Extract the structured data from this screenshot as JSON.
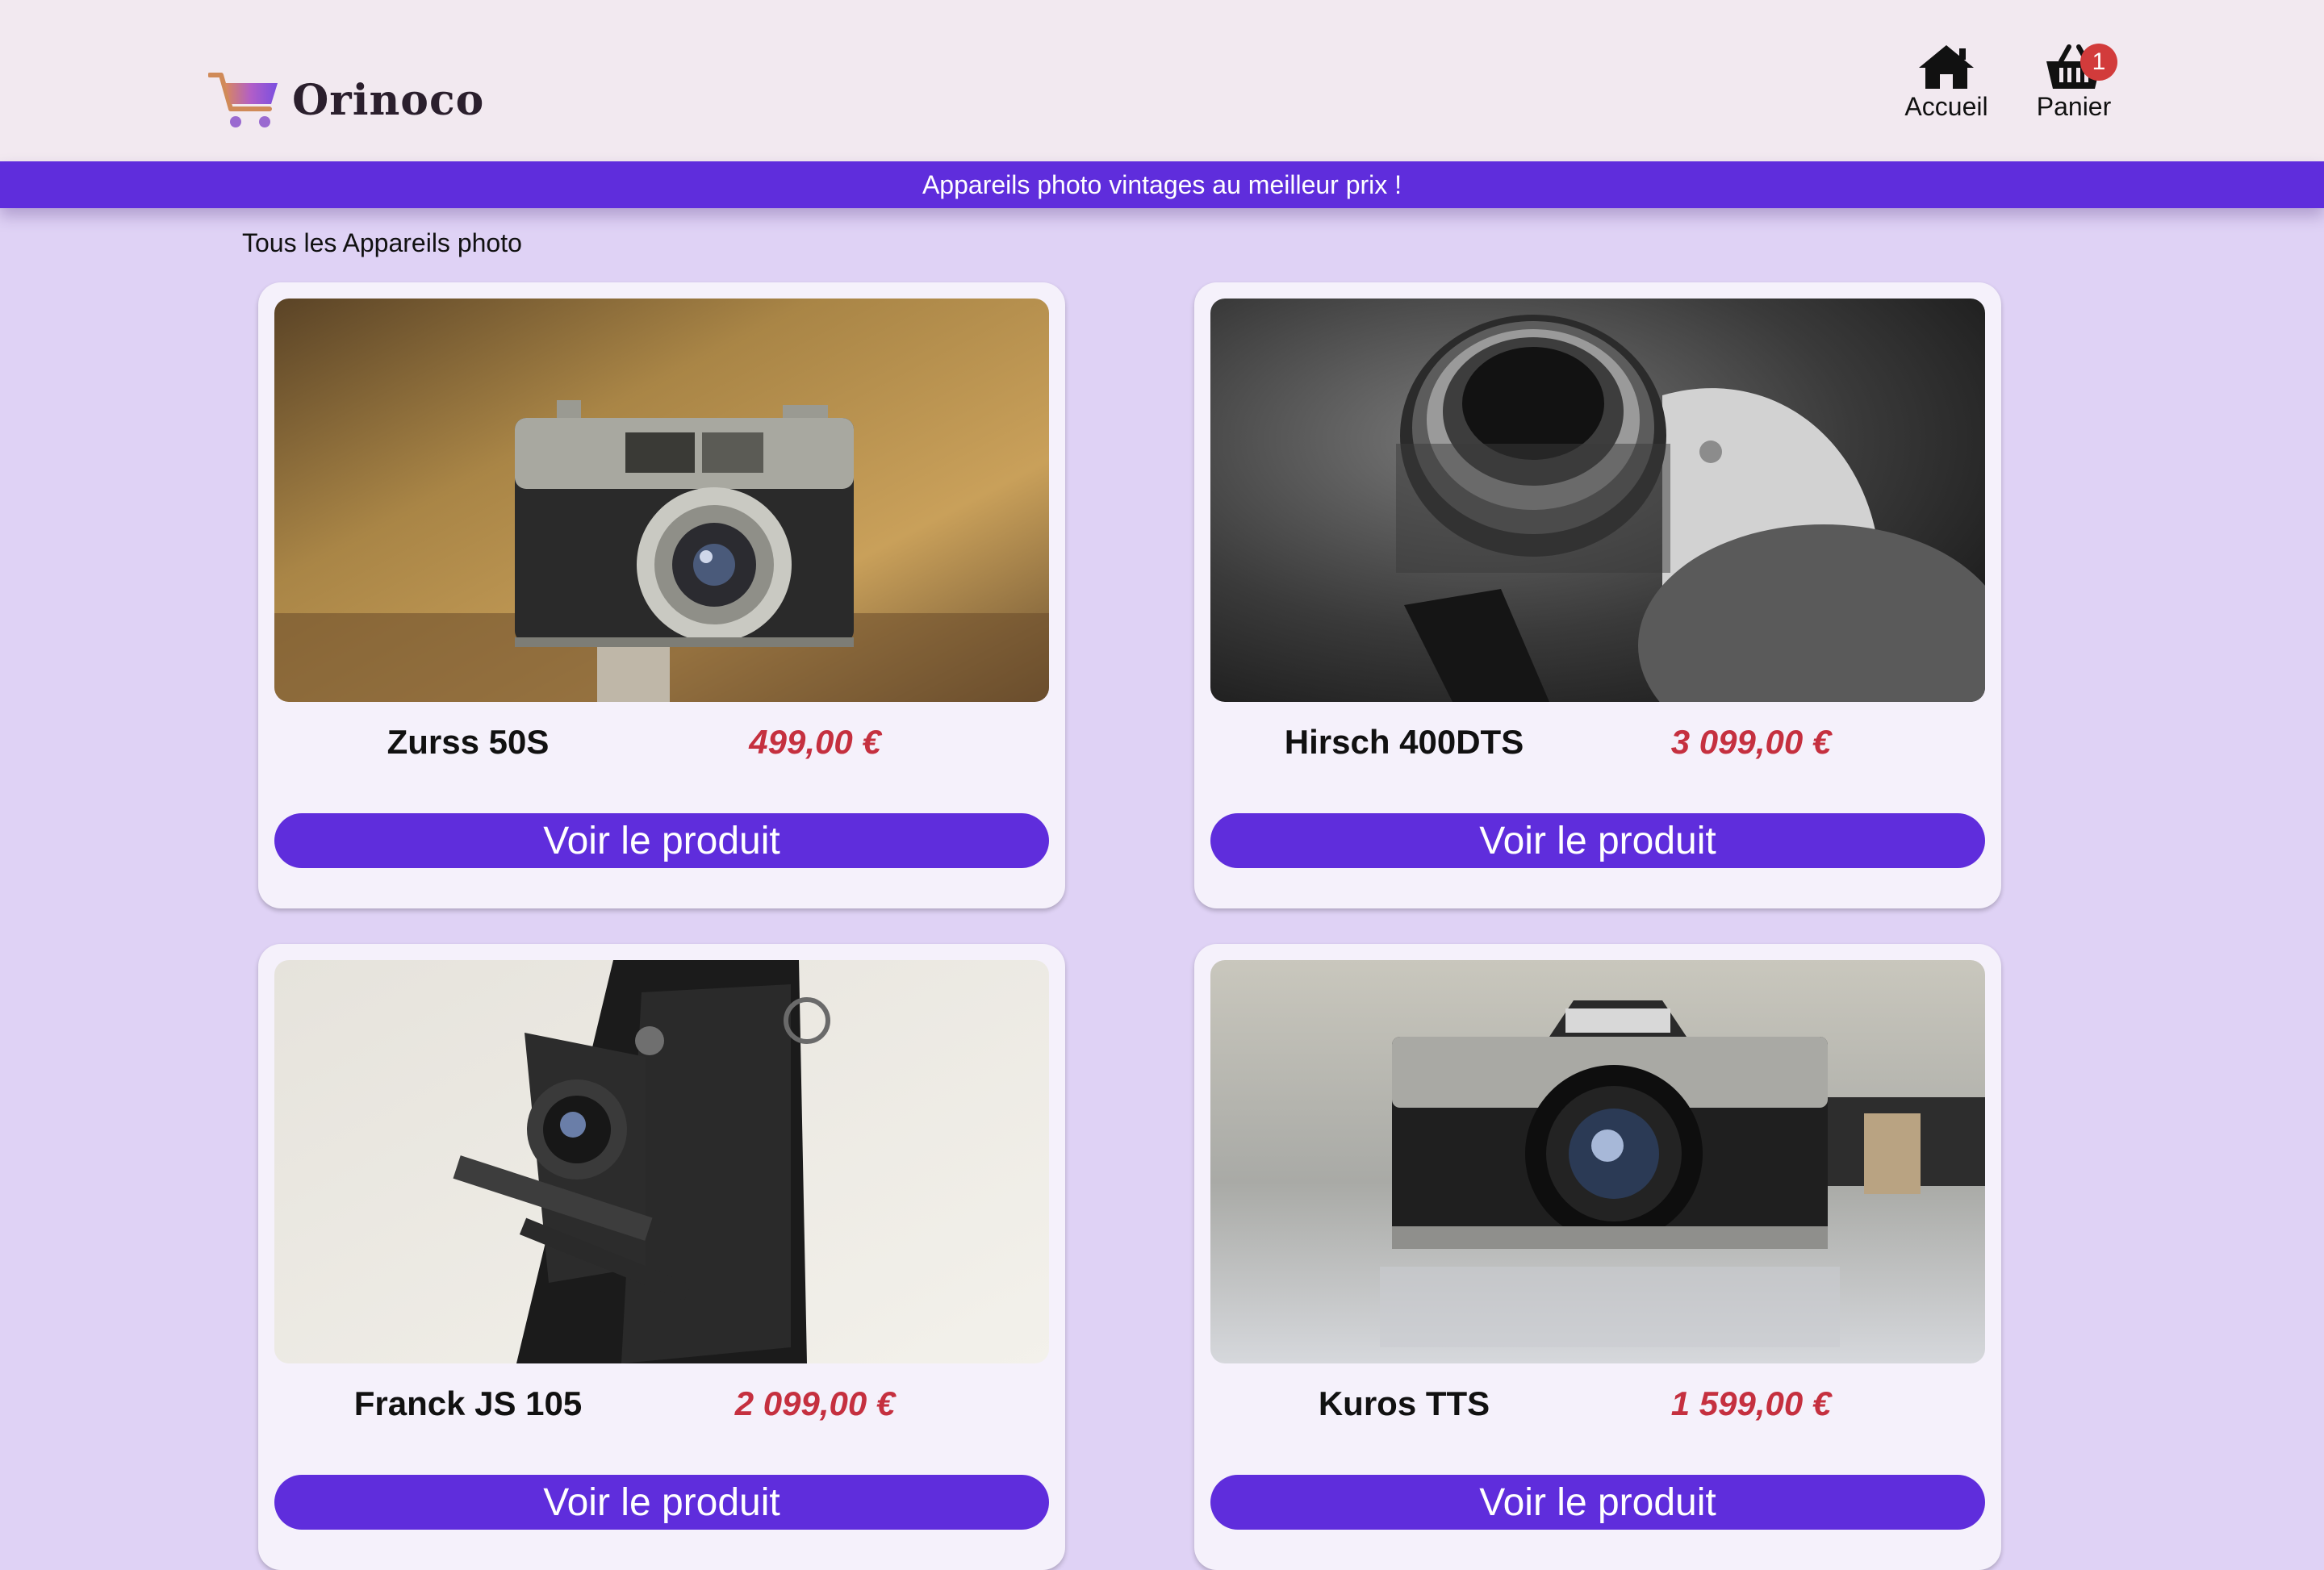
{
  "header": {
    "brand": "Orinoco",
    "nav": {
      "home_label": "Accueil",
      "cart_label": "Panier",
      "cart_count": "1"
    }
  },
  "banner": {
    "text": "Appareils photo vintages au meilleur prix !"
  },
  "catalog": {
    "title": "Tous les Appareils photo",
    "button_label": "Voir le produit",
    "products": [
      {
        "name": "Zurss 50S",
        "price": "499,00 €"
      },
      {
        "name": "Hirsch 400DTS",
        "price": "3 099,00 €"
      },
      {
        "name": "Franck JS 105",
        "price": "2 099,00 €"
      },
      {
        "name": "Kuros TTS",
        "price": "1 599,00 €"
      }
    ]
  },
  "colors": {
    "accent": "#5f2ddc",
    "background": "#dfd2f5",
    "header_bg": "#f2e9f0",
    "price": "#c5303f",
    "badge": "#d23b3b"
  }
}
